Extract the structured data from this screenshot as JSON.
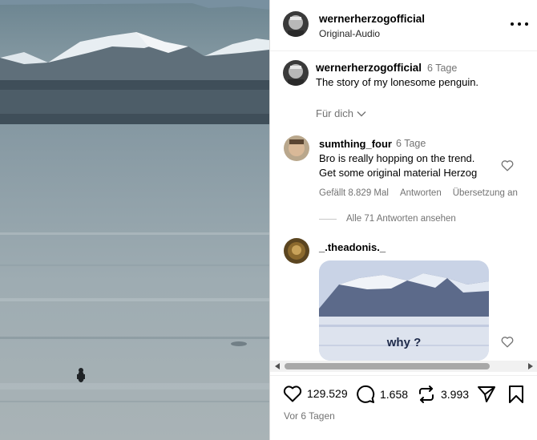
{
  "post": {
    "username": "wernerherzogofficial",
    "audio": "Original-Audio",
    "caption_time": "6 Tage",
    "caption": "The story of my lonesome penguin.",
    "time_ago": "Vor 6 Tagen"
  },
  "feed_filter": "Für dich",
  "comments": [
    {
      "username": "sumthing_four",
      "time": "6 Tage",
      "text_lines": [
        "Bro is really hopping on the trend.",
        "Get some original material Herzog"
      ],
      "likes": "Gefällt 8.829 Mal",
      "reply": "Antworten",
      "translate": "Übersetzung an",
      "view_replies": "Alle 71 Antworten ansehen"
    },
    {
      "username": "_.theadonis._",
      "gif_caption": "why ?"
    }
  ],
  "actions": {
    "likes": "129.529",
    "comments": "1.658",
    "reposts": "3.993"
  },
  "icons": [
    "more-icon",
    "chevron-down-icon",
    "heart-icon",
    "comment-icon",
    "repost-icon",
    "share-icon",
    "bookmark-icon",
    "scroll-left-icon",
    "scroll-right-icon"
  ],
  "colors": {
    "secondary_text": "#737373",
    "border": "#dbdbdb"
  }
}
